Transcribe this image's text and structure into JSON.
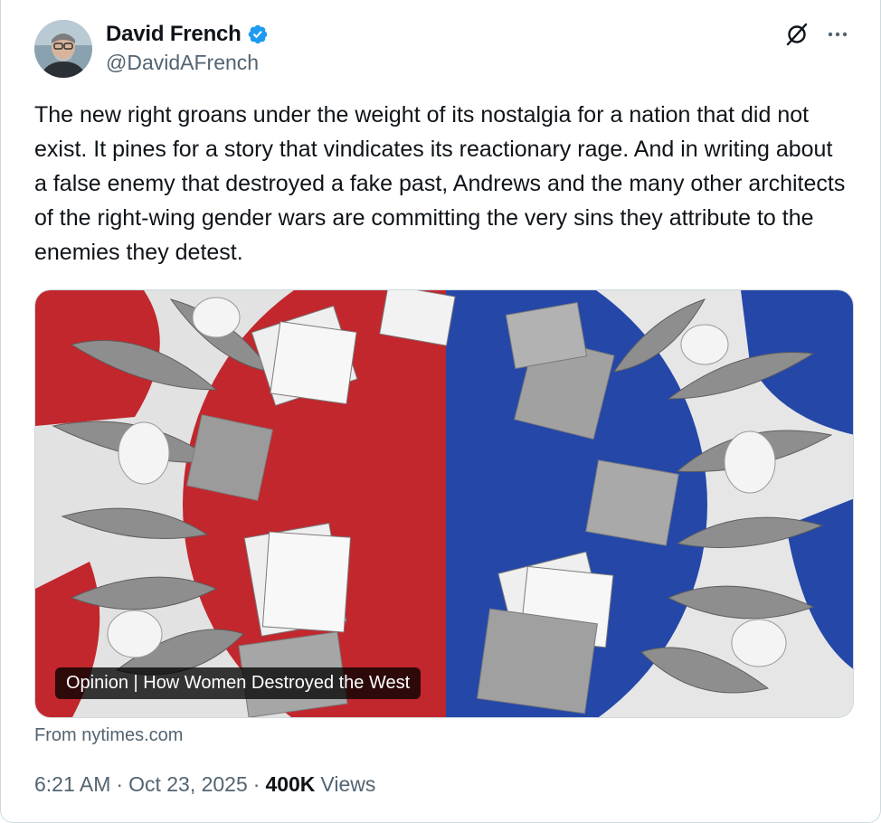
{
  "author": {
    "name": "David French",
    "handle": "@DavidAFrench",
    "verified": true
  },
  "tweet": {
    "text": "The new right groans under the weight of its nostalgia for a nation that did not exist. It pines for a story that vindicates its reactionary rage. And in writing about a false enemy that destroyed a fake past, Andrews and the many other architects of the right-wing gender wars are committing the very sins they attribute to the enemies they detest."
  },
  "link_card": {
    "caption": "Opinion | How Women Destroyed the West",
    "source": "From nytimes.com"
  },
  "meta": {
    "time": "6:21 AM",
    "separator": "·",
    "date": "Oct 23, 2025",
    "views_count": "400K",
    "views_label": "Views"
  },
  "icons": {
    "verified": "verified-badge-icon",
    "grok": "grok-icon",
    "more": "more-dots-icon"
  },
  "colors": {
    "verified_blue": "#1d9bf0",
    "secondary_text": "#536471",
    "art_red": "#c1272d",
    "art_blue": "#2447a8"
  }
}
